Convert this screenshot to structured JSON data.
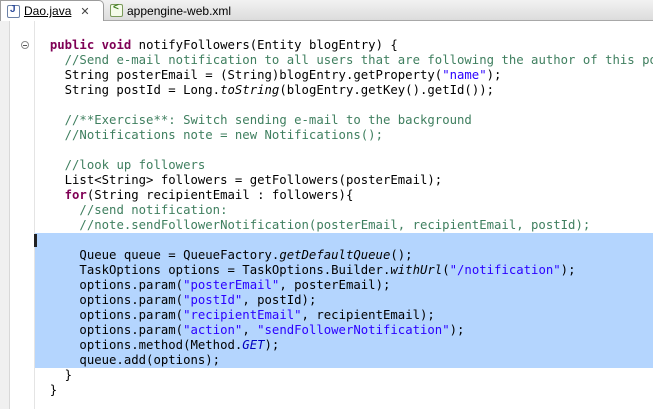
{
  "tabs": [
    {
      "label": "Dao.java",
      "icon": "java-file-icon",
      "active": true,
      "close": "✕"
    },
    {
      "label": "appengine-web.xml",
      "icon": "xml-file-icon",
      "active": false
    }
  ],
  "code_lines": [
    [
      {
        "t": "  ",
        "c": ""
      },
      {
        "t": "public",
        "c": "kw"
      },
      {
        "t": " ",
        "c": ""
      },
      {
        "t": "void",
        "c": "kw"
      },
      {
        "t": " notifyFollowers(Entity blogEntry) {",
        "c": ""
      }
    ],
    [
      {
        "t": "    ",
        "c": ""
      },
      {
        "t": "//Send e-mail notification to all users that are following the author of this post",
        "c": "cm"
      }
    ],
    [
      {
        "t": "    String posterEmail = (String)blogEntry.getProperty(",
        "c": ""
      },
      {
        "t": "\"name\"",
        "c": "st"
      },
      {
        "t": ");",
        "c": ""
      }
    ],
    [
      {
        "t": "    String postId = Long.",
        "c": ""
      },
      {
        "t": "toString",
        "c": "it"
      },
      {
        "t": "(blogEntry.getKey().getId());",
        "c": ""
      }
    ],
    [],
    [
      {
        "t": "    ",
        "c": ""
      },
      {
        "t": "//**Exercise**: Switch sending e-mail to the background",
        "c": "cm"
      }
    ],
    [
      {
        "t": "    ",
        "c": ""
      },
      {
        "t": "//Notifications note = new Notifications();",
        "c": "cm"
      }
    ],
    [],
    [
      {
        "t": "    ",
        "c": ""
      },
      {
        "t": "//look up followers",
        "c": "cm"
      }
    ],
    [
      {
        "t": "    List<String> followers = getFollowers(posterEmail);",
        "c": ""
      }
    ],
    [
      {
        "t": "    ",
        "c": ""
      },
      {
        "t": "for",
        "c": "kw"
      },
      {
        "t": "(String recipientEmail : followers){",
        "c": ""
      }
    ],
    [
      {
        "t": "      ",
        "c": ""
      },
      {
        "t": "//send notification:",
        "c": "cm"
      }
    ],
    [
      {
        "t": "      ",
        "c": ""
      },
      {
        "t": "//note.sendFollowerNotification(posterEmail, recipientEmail, postId);",
        "c": "cm"
      }
    ],
    [],
    [
      {
        "t": "      Queue queue = QueueFactory.",
        "c": ""
      },
      {
        "t": "getDefaultQueue",
        "c": "it"
      },
      {
        "t": "();",
        "c": ""
      }
    ],
    [
      {
        "t": "      TaskOptions options = TaskOptions.Builder.",
        "c": ""
      },
      {
        "t": "withUrl",
        "c": "it"
      },
      {
        "t": "(",
        "c": ""
      },
      {
        "t": "\"/notification\"",
        "c": "st"
      },
      {
        "t": ");",
        "c": ""
      }
    ],
    [
      {
        "t": "      options.param(",
        "c": ""
      },
      {
        "t": "\"posterEmail\"",
        "c": "st"
      },
      {
        "t": ", posterEmail);",
        "c": ""
      }
    ],
    [
      {
        "t": "      options.param(",
        "c": ""
      },
      {
        "t": "\"postId\"",
        "c": "st"
      },
      {
        "t": ", postId);",
        "c": ""
      }
    ],
    [
      {
        "t": "      options.param(",
        "c": ""
      },
      {
        "t": "\"recipientEmail\"",
        "c": "st"
      },
      {
        "t": ", recipientEmail);",
        "c": ""
      }
    ],
    [
      {
        "t": "      options.param(",
        "c": ""
      },
      {
        "t": "\"action\"",
        "c": "st"
      },
      {
        "t": ", ",
        "c": ""
      },
      {
        "t": "\"sendFollowerNotification\"",
        "c": "st"
      },
      {
        "t": ");",
        "c": ""
      }
    ],
    [
      {
        "t": "      options.method(Method.",
        "c": ""
      },
      {
        "t": "GET",
        "c": "sf"
      },
      {
        "t": ");",
        "c": ""
      }
    ],
    [
      {
        "t": "      queue.add(options);",
        "c": ""
      }
    ],
    [
      {
        "t": "    }",
        "c": ""
      }
    ],
    [
      {
        "t": "  }",
        "c": ""
      }
    ]
  ],
  "selected_lines": [
    13,
    14,
    15,
    16,
    17,
    18,
    19,
    20,
    21
  ],
  "colors": {
    "selection": "#b4d5fe",
    "keyword": "#7f0055",
    "comment": "#3f7f5f",
    "string": "#2a00ff",
    "static_field": "#0000c0"
  }
}
